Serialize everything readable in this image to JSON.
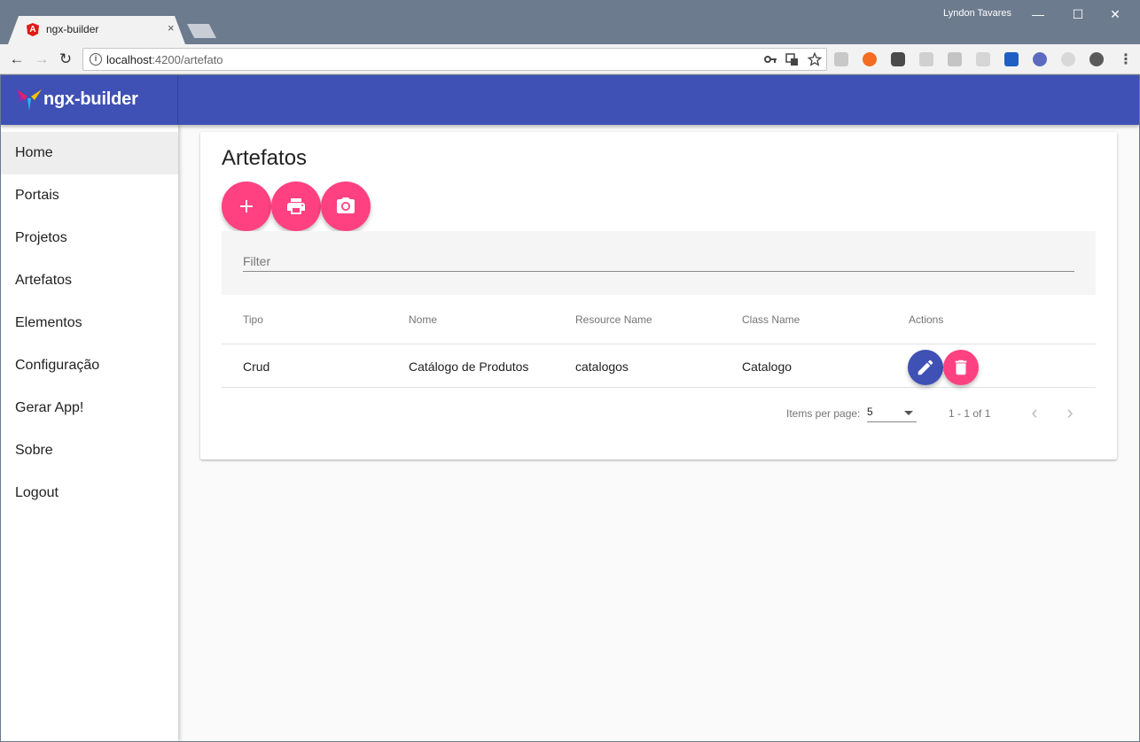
{
  "browser": {
    "tab_title": "ngx-builder",
    "tab_close": "×",
    "profile_name": "Lyndon Tavares",
    "window_controls": {
      "minimize": "—",
      "maximize": "☐",
      "close": "✕"
    },
    "nav": {
      "back": "←",
      "forward": "→",
      "reload": "↻"
    },
    "url_host": "localhost",
    "url_path": ":4200/artefato",
    "info_glyph": "i",
    "menu_glyph": "⋮"
  },
  "app": {
    "brand": "ngx-builder",
    "sidebar": {
      "items": [
        {
          "label": "Home"
        },
        {
          "label": "Portais"
        },
        {
          "label": "Projetos"
        },
        {
          "label": "Artefatos"
        },
        {
          "label": "Elementos"
        },
        {
          "label": "Configuração"
        },
        {
          "label": "Gerar App!"
        },
        {
          "label": "Sobre"
        },
        {
          "label": "Logout"
        }
      ]
    },
    "page_title": "Artefatos",
    "fab_icons": [
      "add-icon",
      "print-icon",
      "camera-icon"
    ],
    "filter": {
      "placeholder": "Filter",
      "value": ""
    },
    "table": {
      "headers": [
        "Tipo",
        "Nome",
        "Resource Name",
        "Class Name",
        "Actions"
      ],
      "rows": [
        {
          "tipo": "Crud",
          "nome": "Catálogo de Produtos",
          "resource_name": "catalogos",
          "class_name": "Catalogo"
        }
      ],
      "action_icons": [
        "edit-icon",
        "delete-icon"
      ]
    },
    "paginator": {
      "items_per_page_label": "Items per page:",
      "page_size": "5",
      "range_label": "1 - 1 of 1",
      "prev": "‹",
      "next": "›"
    },
    "colors": {
      "primary": "#3f51b5",
      "accent": "#ff4081"
    }
  }
}
